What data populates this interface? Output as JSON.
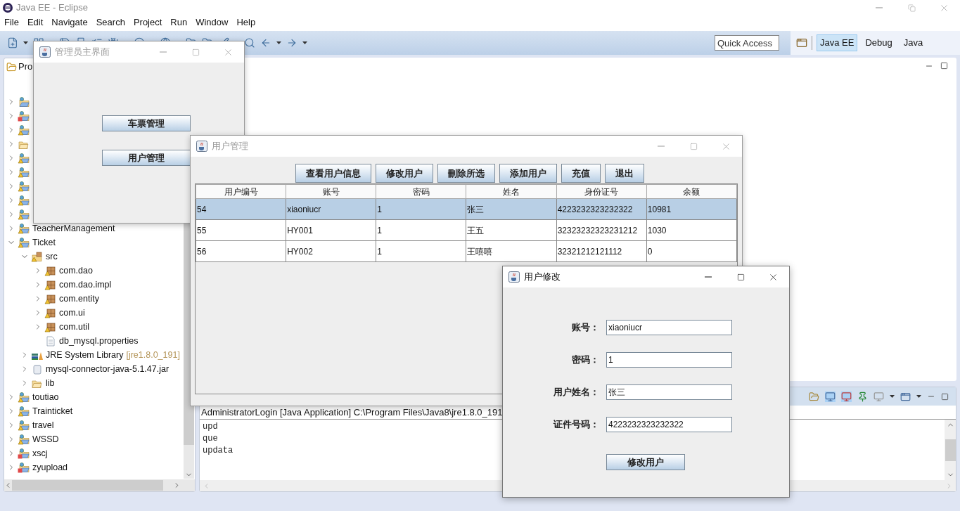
{
  "eclipse": {
    "title": "Java EE - Eclipse",
    "menu": [
      "File",
      "Edit",
      "Navigate",
      "Search",
      "Project",
      "Run",
      "Window",
      "Help"
    ],
    "quick_access": {
      "placeholder": "Quick Access"
    },
    "perspectives": [
      {
        "label": "Java EE",
        "selected": true
      },
      {
        "label": "Debug",
        "selected": false
      },
      {
        "label": "Java",
        "selected": false
      }
    ]
  },
  "project_explorer": {
    "tab": "Pro",
    "tree": [
      {
        "kind": "project",
        "warning": false,
        "error": false,
        "expanded": false
      },
      {
        "kind": "project",
        "warning": false,
        "error": true,
        "expanded": false
      },
      {
        "kind": "project",
        "warning": true,
        "error": false,
        "expanded": false
      },
      {
        "kind": "folder",
        "warning": false,
        "error": false,
        "expanded": false
      },
      {
        "kind": "project",
        "warning": true,
        "error": false,
        "expanded": false
      },
      {
        "kind": "project",
        "warning": true,
        "error": false,
        "expanded": false
      },
      {
        "kind": "project",
        "warning": true,
        "error": false,
        "expanded": false
      },
      {
        "kind": "project",
        "warning": true,
        "error": false,
        "expanded": false
      },
      {
        "kind": "project",
        "warning": true,
        "error": false,
        "expanded": false
      },
      {
        "kind": "project",
        "label": "TeacherManagement",
        "warning": true,
        "error": false,
        "expanded": false
      },
      {
        "kind": "project",
        "label": "Ticket",
        "warning": true,
        "error": false,
        "expanded": true,
        "children": [
          {
            "kind": "source",
            "label": "src",
            "warning": true,
            "error": false,
            "expanded": true,
            "children": [
              {
                "kind": "package",
                "label": "com.dao",
                "warning": true,
                "error": false,
                "expanded": false
              },
              {
                "kind": "package",
                "label": "com.dao.impl",
                "warning": true,
                "error": false,
                "expanded": false
              },
              {
                "kind": "package",
                "label": "com.entity",
                "warning": true,
                "error": false,
                "expanded": false
              },
              {
                "kind": "package",
                "label": "com.ui",
                "warning": true,
                "error": false,
                "expanded": false
              },
              {
                "kind": "package",
                "label": "com.util",
                "warning": true,
                "error": false,
                "expanded": false
              },
              {
                "kind": "file",
                "label": "db_mysql.properties",
                "warning": false,
                "error": false
              }
            ]
          },
          {
            "kind": "library",
            "label": "JRE System Library",
            "note": "[jre1.8.0_191]",
            "warning": false,
            "error": false,
            "expanded": false
          },
          {
            "kind": "jar",
            "label": "mysql-connector-java-5.1.47.jar",
            "warning": false,
            "error": false,
            "expanded": false
          },
          {
            "kind": "folder",
            "label": "lib",
            "warning": false,
            "error": false,
            "expanded": false
          }
        ]
      },
      {
        "kind": "project",
        "label": "toutiao",
        "warning": true,
        "error": false,
        "expanded": false
      },
      {
        "kind": "project",
        "label": "Trainticket",
        "warning": true,
        "error": false,
        "expanded": false
      },
      {
        "kind": "project",
        "label": "travel",
        "warning": true,
        "error": false,
        "expanded": false
      },
      {
        "kind": "project",
        "label": "WSSD",
        "warning": true,
        "error": false,
        "expanded": false
      },
      {
        "kind": "project",
        "label": "xscj",
        "warning": false,
        "error": true,
        "expanded": false
      },
      {
        "kind": "project",
        "label": "zyupload",
        "warning": false,
        "error": true,
        "expanded": false
      }
    ]
  },
  "console": {
    "header": "AdministratorLogin [Java Application] C:\\Program Files\\Java8\\jre1.8.0_191",
    "lines": [
      "upd",
      "que",
      "updata"
    ]
  },
  "admin_window": {
    "title": "管理员主界面",
    "active": false,
    "buttons": [
      "车票管理",
      "用户管理"
    ]
  },
  "user_window": {
    "title": "用户管理",
    "active": false,
    "buttons": [
      "查看用户信息",
      "修改用户",
      "刪除所选",
      "添加用户",
      "充值",
      "退出"
    ],
    "columns": [
      "用户编号",
      "账号",
      "密码",
      "姓名",
      "身份证号",
      "余额"
    ],
    "rows": [
      {
        "selected": true,
        "cells": [
          "54",
          "xiaoniucr",
          "1",
          "张三",
          "4223232323232322",
          "10981"
        ]
      },
      {
        "selected": false,
        "cells": [
          "55",
          "HY001",
          "1",
          "王五",
          "32323232323231212",
          "1030"
        ]
      },
      {
        "selected": false,
        "cells": [
          "56",
          "HY002",
          "1",
          "王嘻嘻",
          "32321212121112",
          "0"
        ]
      }
    ]
  },
  "edit_window": {
    "title": "用户修改",
    "active": true,
    "fields": [
      {
        "label": "账号：",
        "value": "xiaoniucr"
      },
      {
        "label": "密码：",
        "value": "1"
      },
      {
        "label": "用户姓名：",
        "value": "张三"
      },
      {
        "label": "证件号码：",
        "value": "4223232323232322"
      }
    ],
    "button": "修改用户"
  }
}
